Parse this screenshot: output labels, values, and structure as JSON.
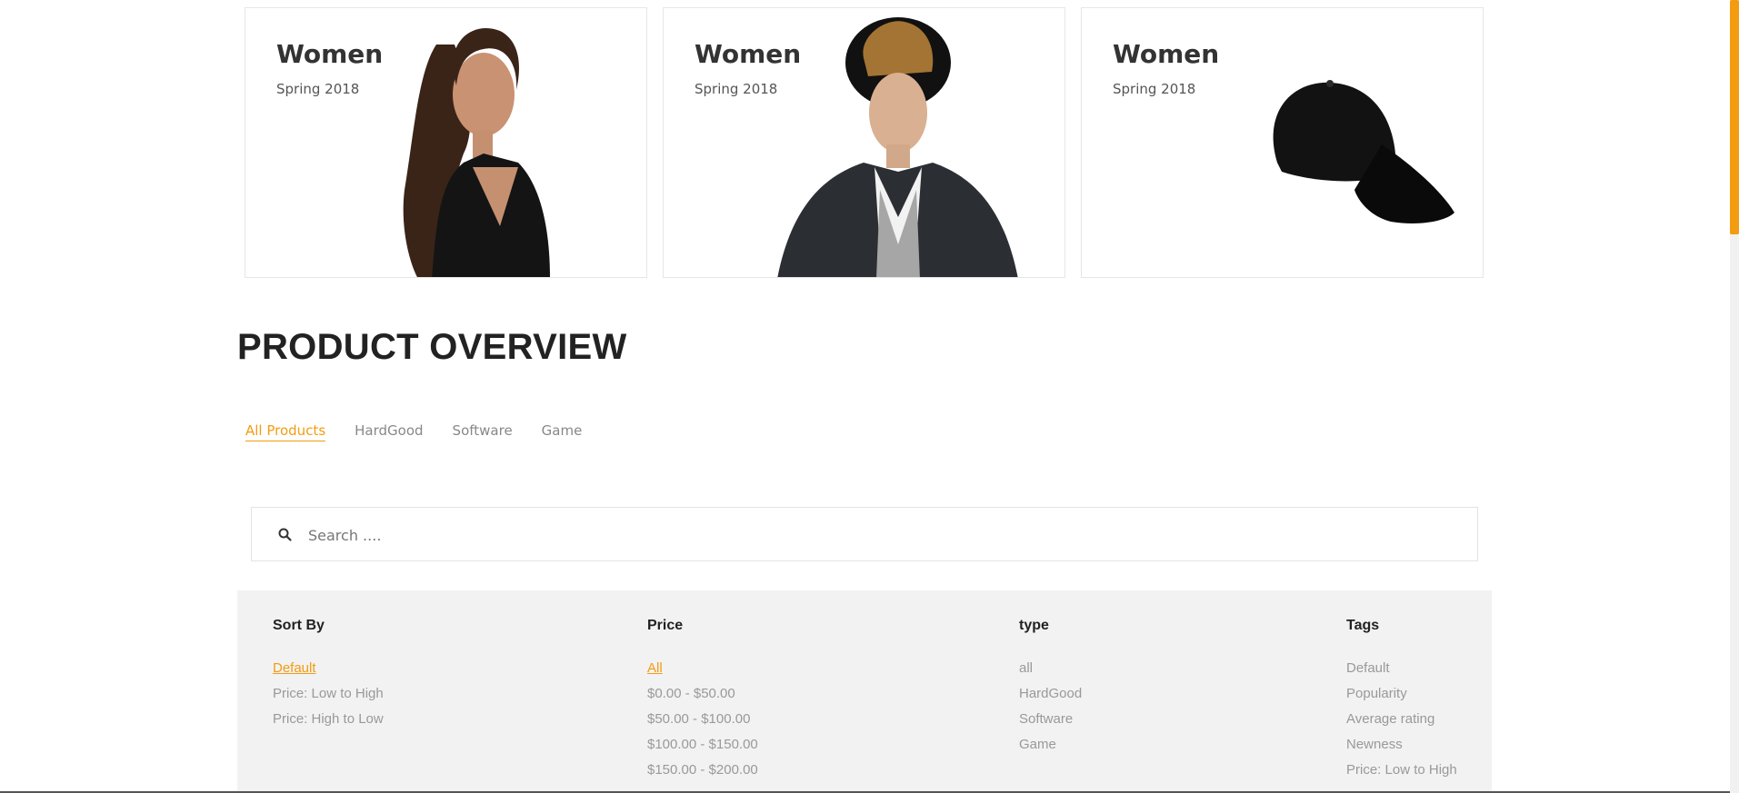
{
  "banners": [
    {
      "title": "Women",
      "subtitle": "Spring 2018"
    },
    {
      "title": "Women",
      "subtitle": "Spring 2018"
    },
    {
      "title": "Women",
      "subtitle": "Spring 2018"
    }
  ],
  "section_title": "PRODUCT OVERVIEW",
  "filter_tabs": [
    "All Products",
    "HardGood",
    "Software",
    "Game"
  ],
  "search": {
    "placeholder": "Search ....",
    "icon": "search-icon"
  },
  "filters": {
    "sort_by": {
      "title": "Sort By",
      "options": [
        "Default",
        "Price: Low to High",
        "Price: High to Low"
      ]
    },
    "price": {
      "title": "Price",
      "options": [
        "All",
        "$0.00 - $50.00",
        "$50.00 - $100.00",
        "$100.00 - $150.00",
        "$150.00 - $200.00"
      ]
    },
    "type": {
      "title": "type",
      "options": [
        "all",
        "HardGood",
        "Software",
        "Game"
      ]
    },
    "tags": {
      "title": "Tags",
      "options": [
        "Default",
        "Popularity",
        "Average rating",
        "Newness",
        "Price: Low to High"
      ]
    }
  },
  "colors": {
    "accent": "#f39c12",
    "text_dark": "#222222",
    "muted": "#999999",
    "panel_bg": "#f2f2f2"
  }
}
